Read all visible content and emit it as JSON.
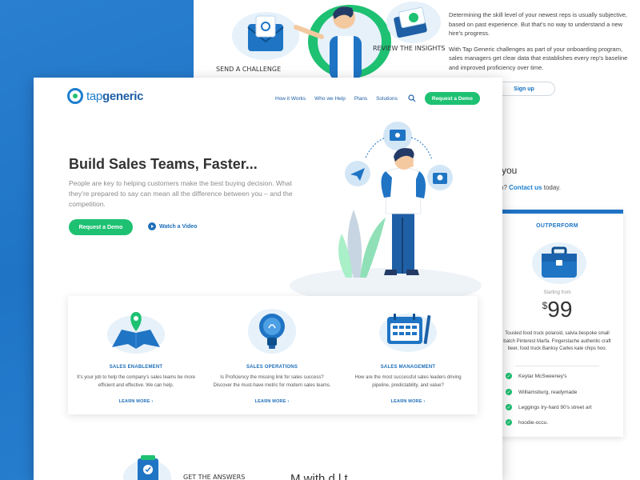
{
  "back_page": {
    "illustration": {
      "send_label": "SEND A CHALLENGE",
      "review_label": "REVIEW THE INSIGHTS"
    },
    "paragraphs": [
      "Determining the skill level of your newest reps is usually subjective, based on past experience. But that’s no way to understand a new hire’s progress.",
      "With Tap Generic challenges as part of your onboarding program, sales managers get clear data that establishes every rep’s baseline and improved proficiency over time."
    ],
    "signup_label": "Sign up",
    "partial_heading": "you",
    "contact_prefix": "n?",
    "contact_link": "Contact us",
    "contact_suffix": "today."
  },
  "pricing": {
    "plan": "OUTPERFORM",
    "starting_from": "Starting from",
    "currency": "$",
    "amount": "99",
    "description": "Tousled food truck polaroid, salvia bespoke small batch Pinterest Marfa. Fingerstache authentic craft beer, food truck Banksy Carles kale chips hoo.",
    "features": [
      "Keytar McSweeney's",
      "Williamsburg, readymade",
      "Leggings try-hard 90's street art",
      "hoodie-occu."
    ]
  },
  "header": {
    "logo_prefix": "tap",
    "logo_suffix": "generic",
    "nav": [
      "How it Works",
      "Who we Help",
      "Plans",
      "Solutions"
    ],
    "cta": "Request a Demo"
  },
  "hero": {
    "title": "Build Sales Teams, Faster...",
    "subtitle": "People  are key to helping customers make the best buying decision. What they’re prepared to say can mean all the difference between you – and the competition.",
    "cta": "Request a Demo",
    "video": "Watch a Video"
  },
  "features": [
    {
      "title": "SALES ENABLEMENT",
      "desc": "It’s your job to help the company’s sales teams be more efficient and effective. We can help.",
      "link": "LEARN MORE ›"
    },
    {
      "title": "SALES OPERATIONS",
      "desc": "Is Proficiency the missing link for sales success? Discover the must-have metric for modern sales teams.",
      "link": "LEARN MORE ›"
    },
    {
      "title": "SALES MANAGEMENT",
      "desc": "How are the most successful sales leaders driving pipeline, predictability, and value?",
      "link": "LEARN MORE ›"
    }
  ],
  "bottom": {
    "illus_label": "GET THE ANSWERS",
    "heading": "M                  with   d  l  t"
  },
  "colors": {
    "brand_blue": "#1f7fce",
    "accent_green": "#1ec172",
    "nav_blue": "#1e5fa5"
  }
}
